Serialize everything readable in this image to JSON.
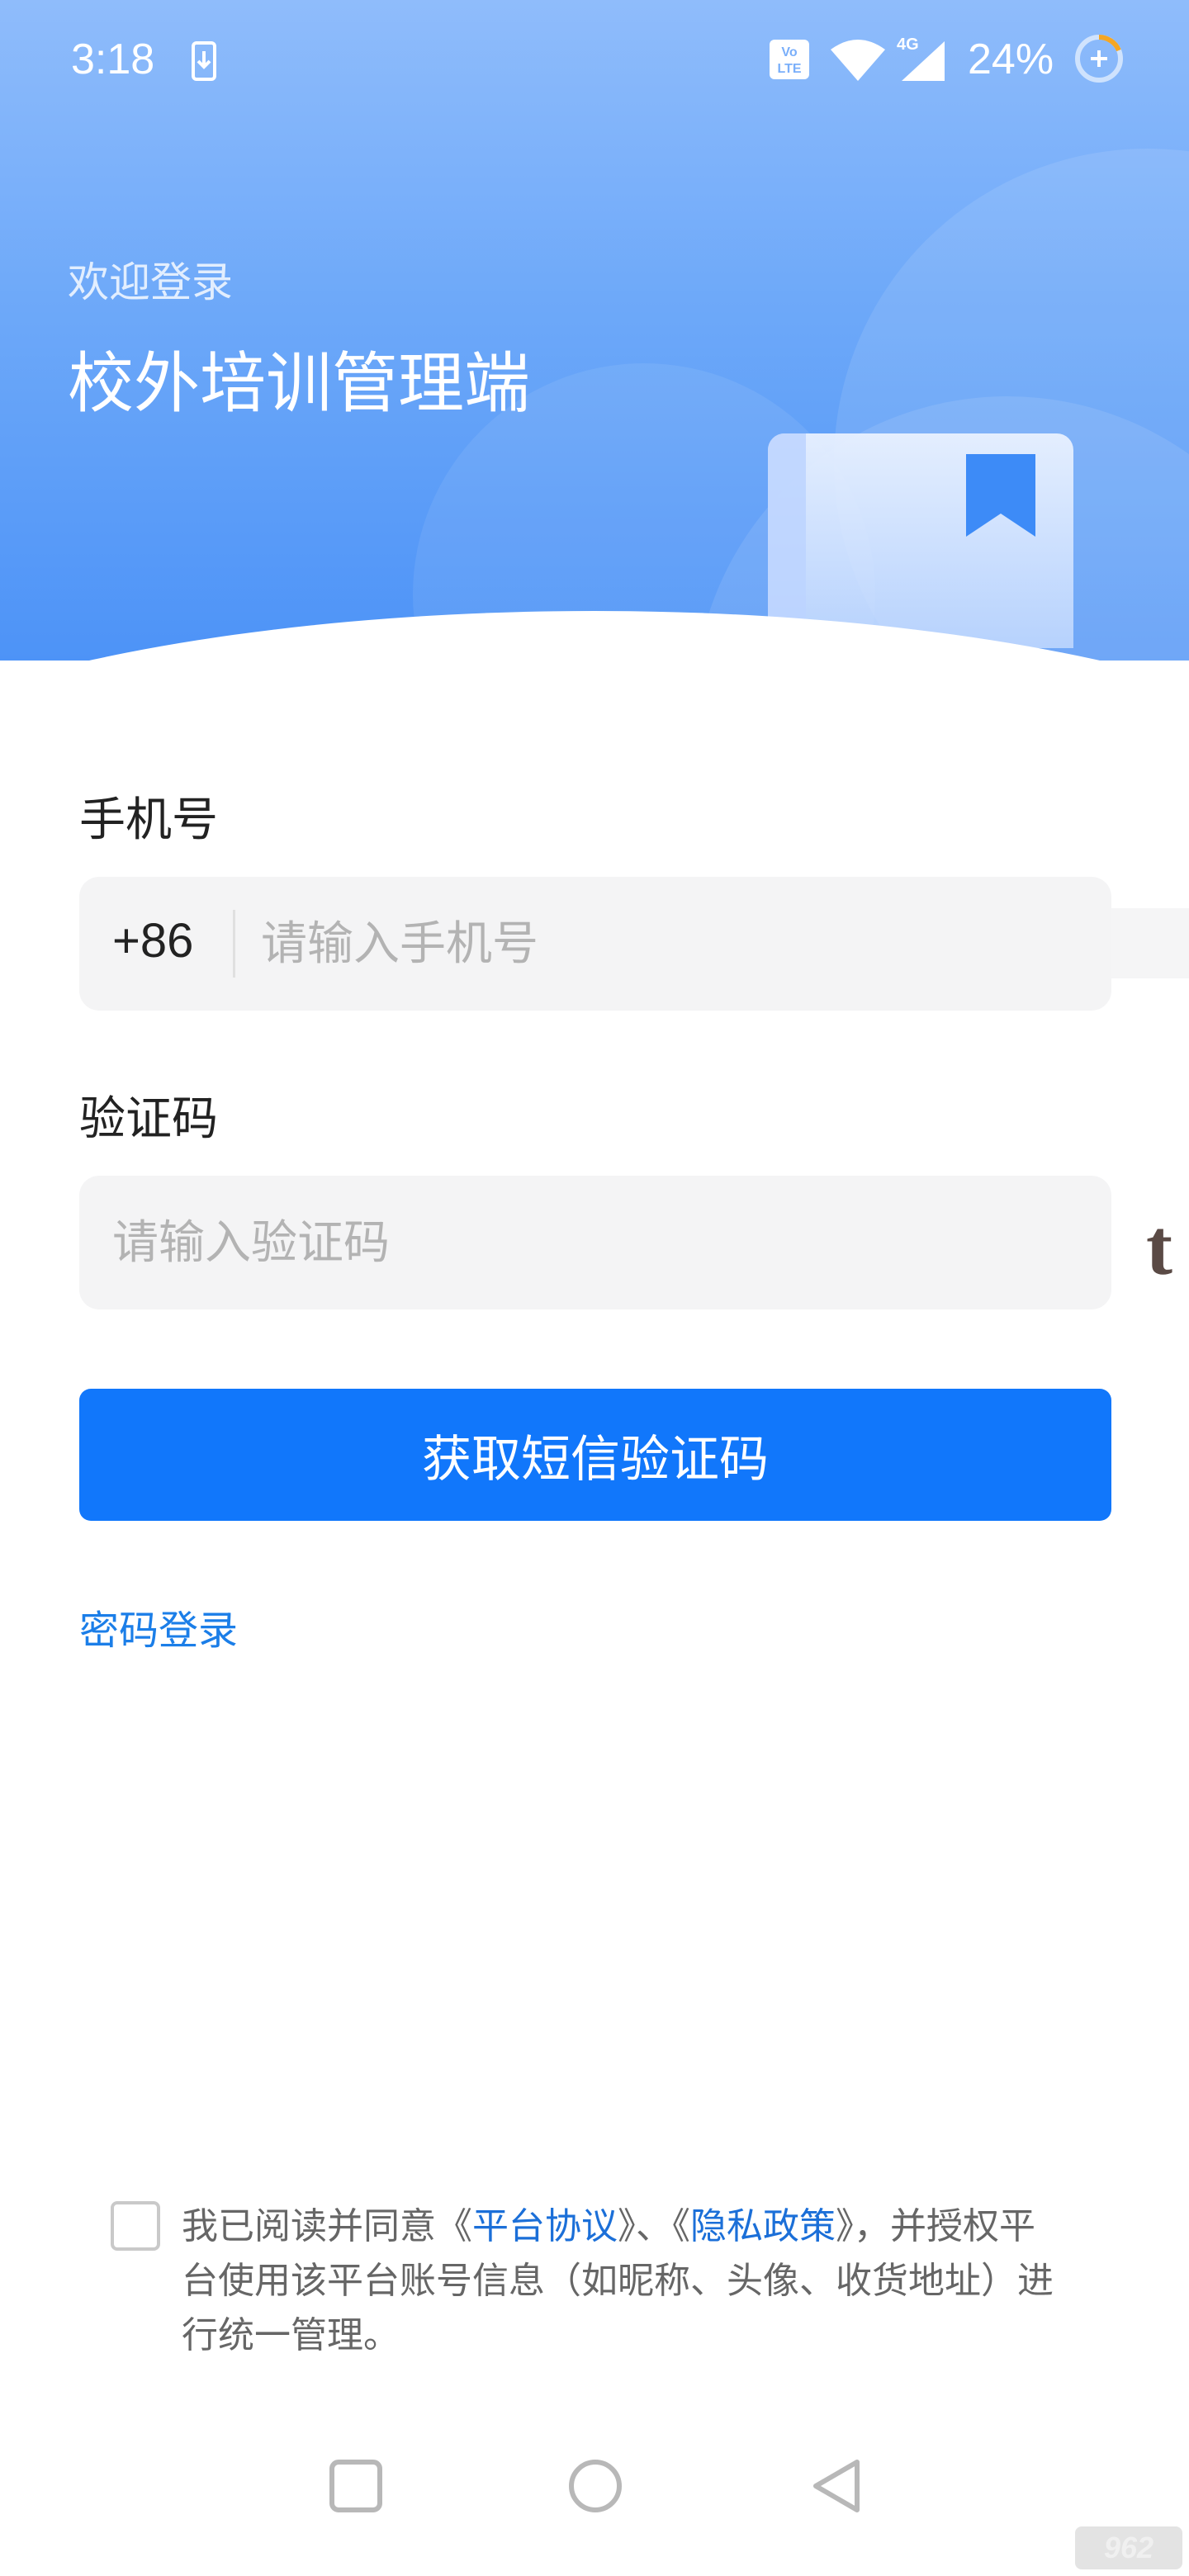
{
  "status_bar": {
    "time": "3:18",
    "battery_percent": "24%",
    "network": "4G",
    "volte": "VoLTE"
  },
  "header": {
    "welcome": "欢迎登录",
    "title": "校外培训管理端"
  },
  "form": {
    "phone_label": "手机号",
    "country_code": "+86",
    "phone_placeholder": "请输入手机号",
    "code_label": "验证码",
    "code_placeholder": "请输入验证码",
    "submit_label": "获取短信验证码",
    "password_login": "密码登录"
  },
  "agreement": {
    "prefix": "我已阅读并同意",
    "open1": "《",
    "platform_agreement": "平台协议",
    "close1": "》",
    "separator": "、",
    "open2": "《",
    "privacy_policy": "隐私政策",
    "close2": "》",
    "suffix": "，并授权平台使用该平台账号信息（如昵称、头像、收货地址）进行统一管理。",
    "checked": false
  },
  "side_glyph": "t",
  "watermark": "962",
  "colors": {
    "primary": "#1177fb",
    "link": "#1b7ee8",
    "header_top": "#8fbcfb",
    "header_bottom": "#4d93f7"
  },
  "icons": [
    "download-icon",
    "volte-icon",
    "wifi-icon",
    "signal-icon",
    "battery-icon",
    "bookmark-icon",
    "recents-icon",
    "home-icon",
    "back-icon"
  ]
}
